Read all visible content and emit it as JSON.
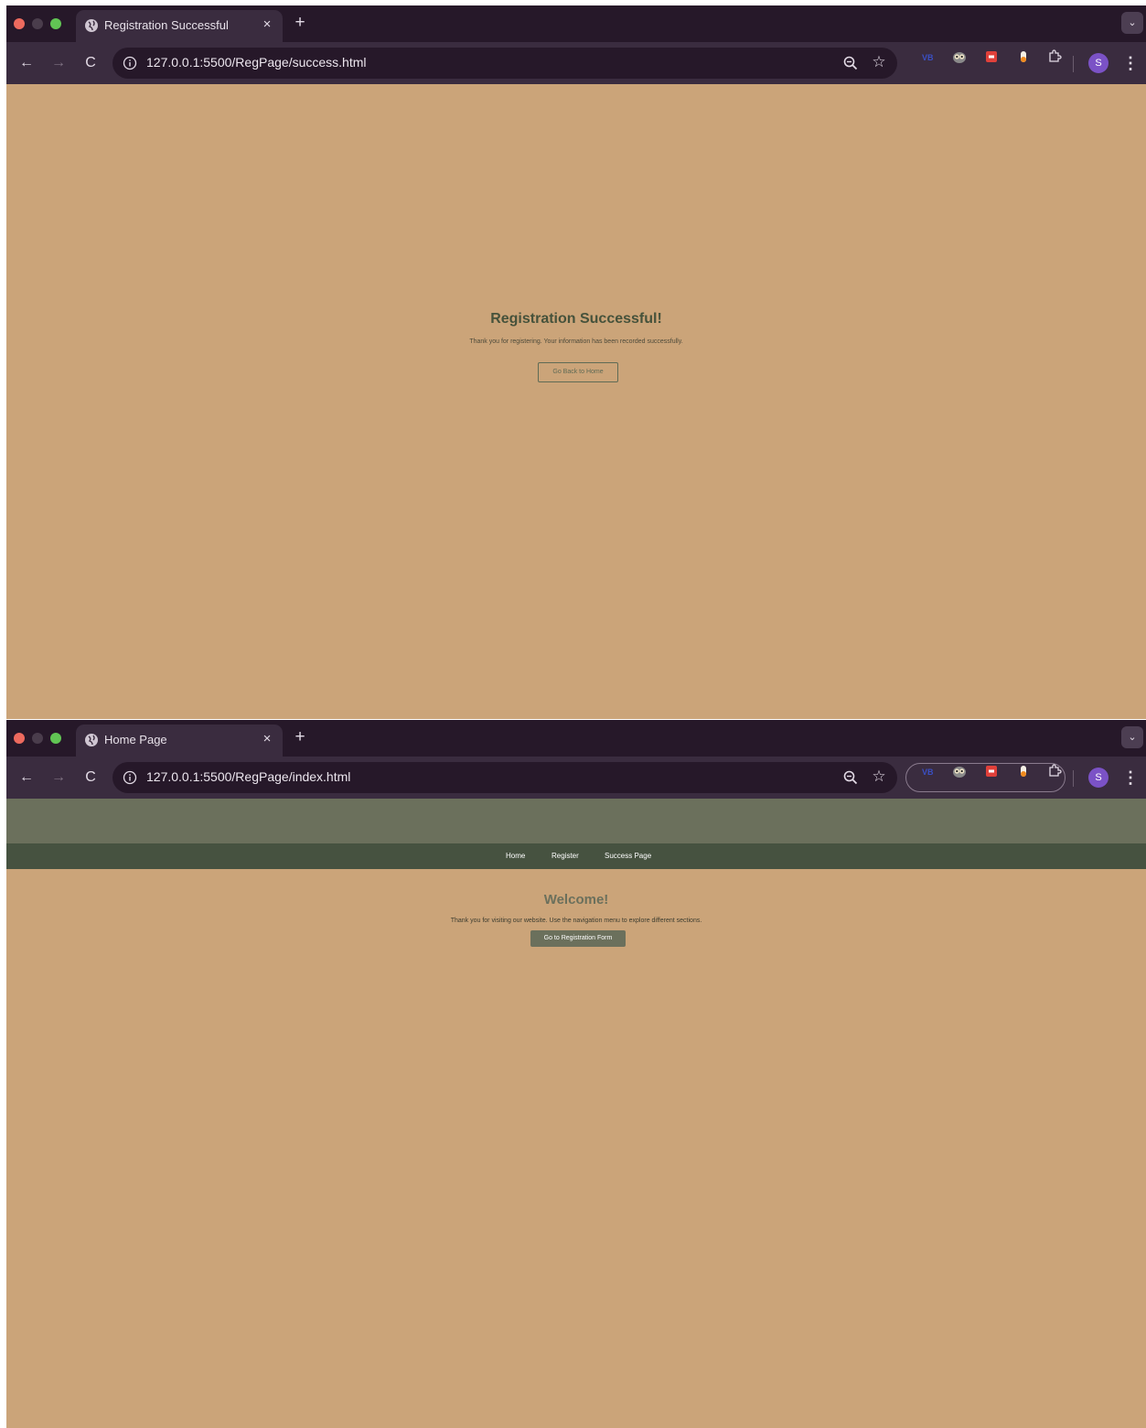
{
  "window_success": {
    "tab_title": "Registration Successful",
    "url": "127.0.0.1:5500/RegPage/success.html",
    "page": {
      "title": "Registration Successful!",
      "message": "Thank you for registering. Your information has been recorded successfully.",
      "button_label": "Go Back to Home"
    }
  },
  "window_home": {
    "tab_title": "Home Page",
    "url": "127.0.0.1:5500/RegPage/index.html",
    "page": {
      "nav": [
        "Home",
        "Register",
        "Success Page"
      ],
      "title": "Welcome!",
      "message": "Thank you for visiting our website. Use the navigation menu to explore different sections.",
      "button_label": "Go to Registration Form"
    }
  },
  "browser": {
    "profile_initial": "S",
    "new_tab_glyph": "+",
    "close_glyph": "×",
    "tab_menu_glyph": "⌄",
    "back_glyph": "←",
    "forward_glyph": "→",
    "reload_glyph": "C",
    "star_glyph": "☆",
    "menu_glyph": "⋮",
    "extension_label": "VB"
  },
  "colors": {
    "page_background": "#cba479",
    "header": "#6b705c",
    "nav": "#465240",
    "title_text": "#46523b",
    "browser_frame": "#261829",
    "browser_toolbar": "#3a2c3f",
    "profile_avatar": "#7b52c6"
  },
  "icons": {
    "tab_favicon": "globe-icon",
    "site_info": "info-icon",
    "zoom": "zoom-icon",
    "bookmark": "star-icon",
    "extensions": [
      "vb-extension-icon",
      "owl-extension-icon",
      "red-extension-icon",
      "pill-extension-icon",
      "puzzle-icon"
    ],
    "menu": "kebab-menu-icon"
  }
}
